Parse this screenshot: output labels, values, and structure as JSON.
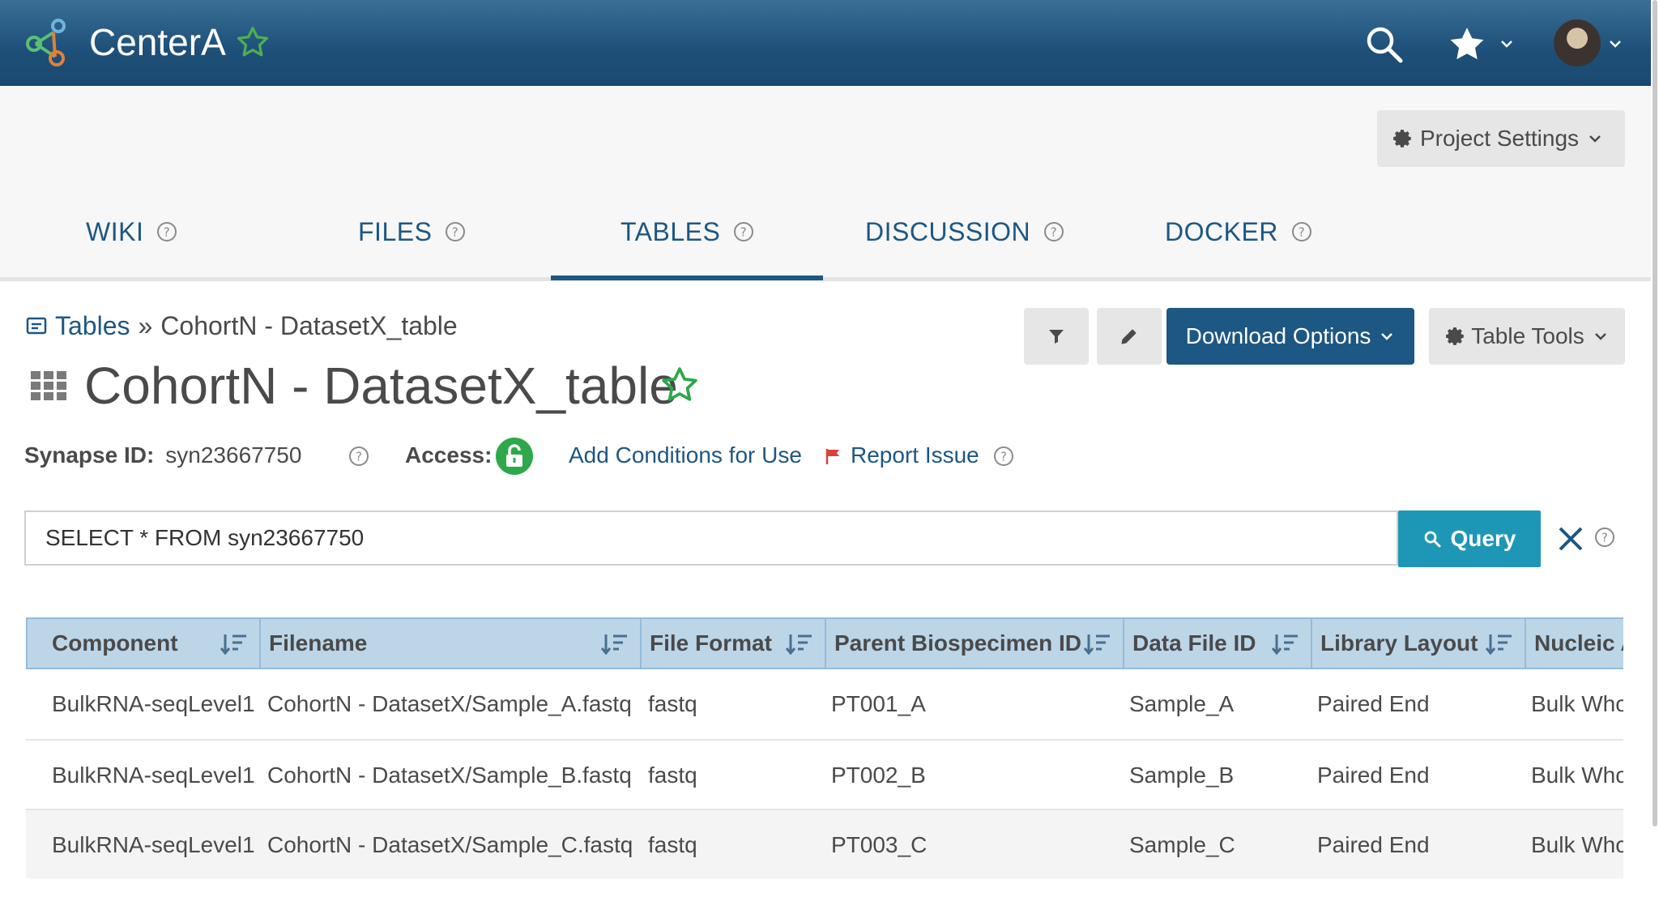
{
  "header": {
    "brand": "CenterA",
    "colors": {
      "bar": "#1d4f78",
      "accent_star": "#4caf50",
      "link": "#1d5783",
      "query": "#1d97b5"
    }
  },
  "project": {
    "settings_label": "Project Settings",
    "tabs": [
      {
        "label": "WIKI"
      },
      {
        "label": "FILES"
      },
      {
        "label": "TABLES"
      },
      {
        "label": "DISCUSSION"
      },
      {
        "label": "DOCKER"
      }
    ],
    "active_tab": "TABLES"
  },
  "breadcrumb": {
    "root": "Tables",
    "separator": "»",
    "current": "CohortN - DatasetX_table"
  },
  "entity": {
    "title": "CohortN - DatasetX_table",
    "synapse_id_label": "Synapse ID:",
    "synapse_id": "syn23667750",
    "access_label": "Access:",
    "add_conditions": "Add Conditions for Use",
    "report_issue": "Report Issue"
  },
  "toolbar": {
    "download_label": "Download Options",
    "table_tools_label": "Table Tools"
  },
  "query": {
    "text": "SELECT * FROM syn23667750",
    "button_label": "Query"
  },
  "table": {
    "columns": [
      "Component",
      "Filename",
      "File Format",
      "Parent Biospecimen ID",
      "Data File ID",
      "Library Layout",
      "Nucleic A"
    ],
    "rows": [
      [
        "BulkRNA-seqLevel1",
        "CohortN - DatasetX/Sample_A.fastq",
        "fastq",
        "PT001_A",
        "Sample_A",
        "Paired End",
        "Bulk Who"
      ],
      [
        "BulkRNA-seqLevel1",
        "CohortN - DatasetX/Sample_B.fastq",
        "fastq",
        "PT002_B",
        "Sample_B",
        "Paired End",
        "Bulk Who"
      ],
      [
        "BulkRNA-seqLevel1",
        "CohortN - DatasetX/Sample_C.fastq",
        "fastq",
        "PT003_C",
        "Sample_C",
        "Paired End",
        "Bulk Who"
      ]
    ]
  }
}
